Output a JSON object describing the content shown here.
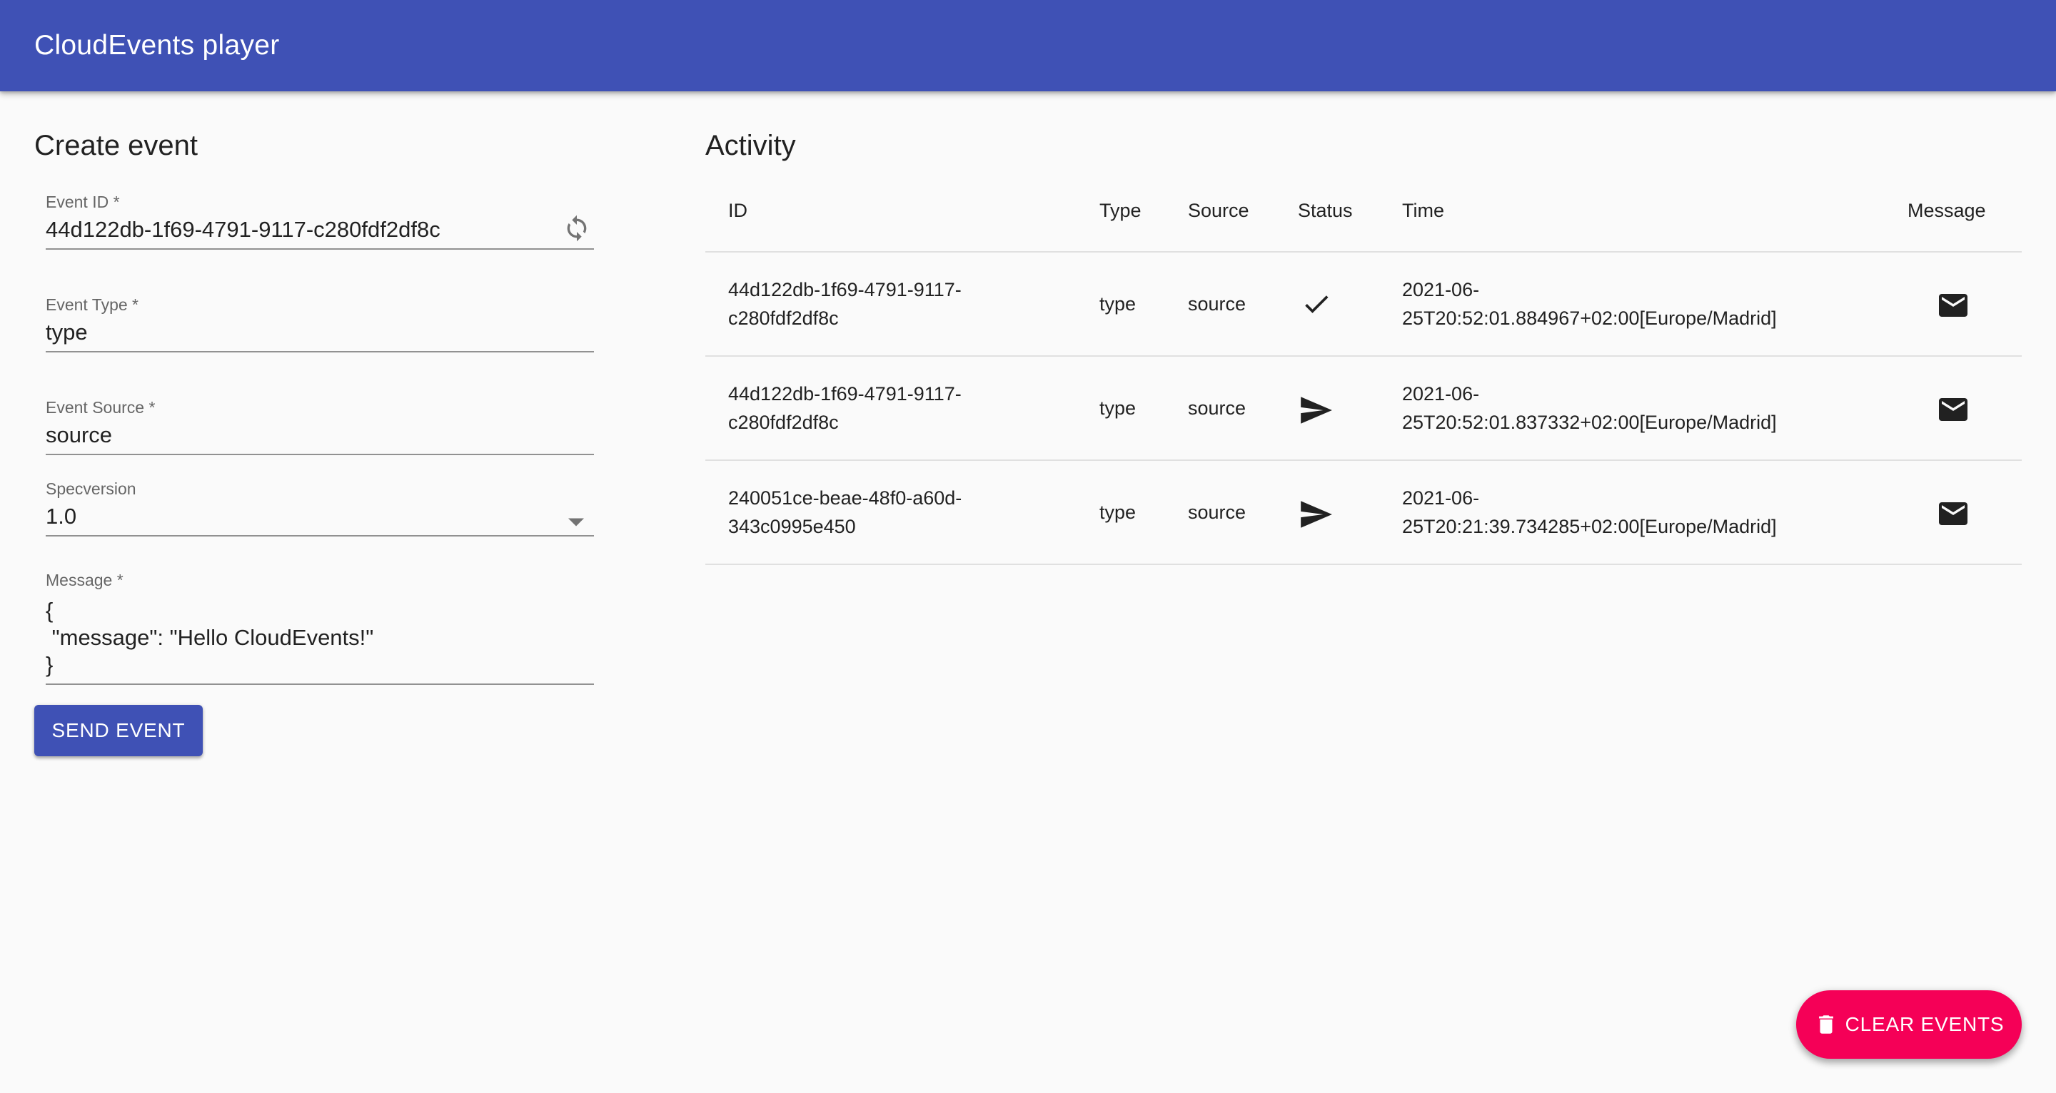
{
  "app": {
    "title": "CloudEvents player"
  },
  "create_event": {
    "title": "Create event",
    "fields": {
      "event_id": {
        "label": "Event ID *",
        "value": "44d122db-1f69-4791-9117-c280fdf2df8c"
      },
      "event_type": {
        "label": "Event Type *",
        "value": "type"
      },
      "event_source": {
        "label": "Event Source *",
        "value": "source"
      },
      "specversion": {
        "label": "Specversion",
        "value": "1.0"
      },
      "message": {
        "label": "Message *",
        "lines": [
          "{",
          " \"message\": \"Hello CloudEvents!\"",
          "}"
        ]
      }
    },
    "send_label": "SEND EVENT"
  },
  "activity": {
    "title": "Activity",
    "columns": {
      "id": "ID",
      "type": "Type",
      "source": "Source",
      "status": "Status",
      "time": "Time",
      "message": "Message"
    },
    "rows": [
      {
        "id1": "44d122db-1f69-4791-9117-",
        "id2": "c280fdf2df8c",
        "type": "type",
        "source": "source",
        "status_icon": "check-icon",
        "time1": "2021-06-",
        "time2": "25T20:52:01.884967+02:00[Europe/Madrid]",
        "message_icon": "mail-icon"
      },
      {
        "id1": "44d122db-1f69-4791-9117-",
        "id2": "c280fdf2df8c",
        "type": "type",
        "source": "source",
        "status_icon": "send-icon",
        "time1": "2021-06-",
        "time2": "25T20:52:01.837332+02:00[Europe/Madrid]",
        "message_icon": "mail-icon"
      },
      {
        "id1": "240051ce-beae-48f0-a60d-",
        "id2": "343c0995e450",
        "type": "type",
        "source": "source",
        "status_icon": "send-icon",
        "time1": "2021-06-",
        "time2": "25T20:21:39.734285+02:00[Europe/Madrid]",
        "message_icon": "mail-icon"
      }
    ]
  },
  "clear_label": "CLEAR EVENTS",
  "colors": {
    "primary": "#3f51b5",
    "secondary": "#f50057",
    "background": "#fafafa"
  }
}
